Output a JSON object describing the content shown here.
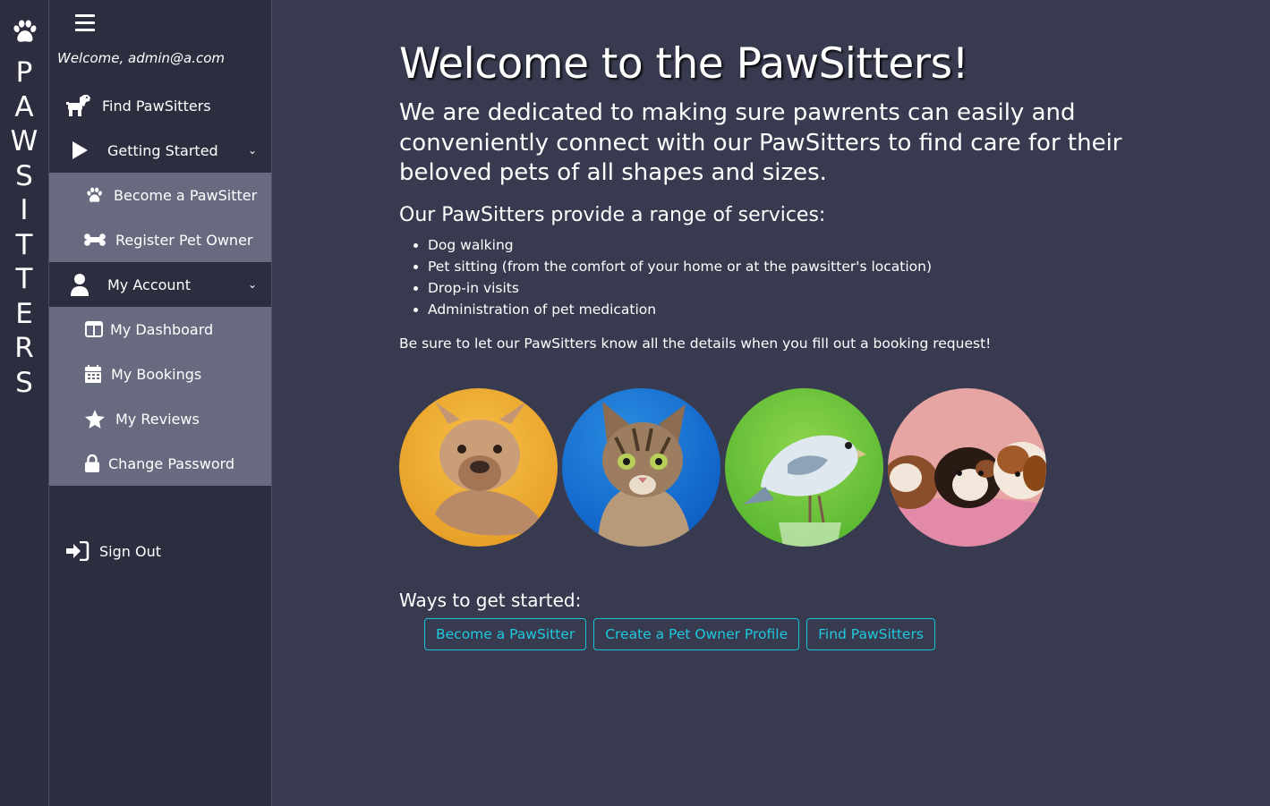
{
  "brand": {
    "letters": [
      "P",
      "A",
      "W",
      "S",
      "I",
      "T",
      "T",
      "E",
      "R",
      "S"
    ],
    "logo_icon": "paw-icon"
  },
  "sidebar": {
    "welcome": "Welcome, admin@a.com",
    "find": "Find PawSitters",
    "getting_started": "Getting Started",
    "getting_started_items": [
      "Become a PawSitter",
      "Register Pet Owner"
    ],
    "my_account": "My Account",
    "account_items": [
      "My Dashboard",
      "My Bookings",
      "My Reviews",
      "Change Password"
    ],
    "sign_out": "Sign Out"
  },
  "main": {
    "title": "Welcome to the PawSitters!",
    "intro": "We are dedicated to making sure pawrents can easily and conveniently connect with our PawSitters to find care for their beloved pets of all shapes and sizes.",
    "services_heading": "Our PawSitters provide a range of services:",
    "services": [
      "Dog walking",
      "Pet sitting (from the comfort of your home or at the pawsitter's location)",
      "Drop-in visits",
      "Administration of pet medication"
    ],
    "note": "Be sure to let our PawSitters know all the details when you fill out a booking request!",
    "pets": [
      "dog",
      "cat",
      "budgie",
      "guinea pigs"
    ],
    "start_heading": "Ways to get started:",
    "buttons": [
      "Become a PawSitter",
      "Create a Pet Owner Profile",
      "Find PawSitters"
    ]
  },
  "colors": {
    "background": "#383b4f",
    "sidebar": "#2c2e40",
    "submenu": "#686a80",
    "accent": "#1fc8dc"
  }
}
